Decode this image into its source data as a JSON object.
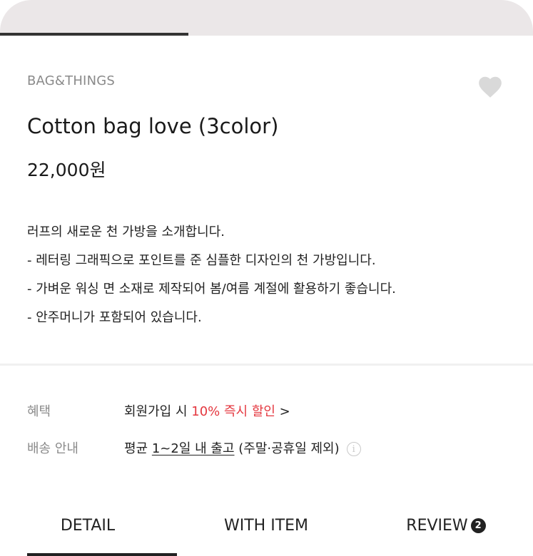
{
  "progress": {
    "value": 0.353
  },
  "product": {
    "brand": "BAG&THINGS",
    "title": "Cotton bag love (3color)",
    "price": "22,000원",
    "wishlist_icon": "heart-icon",
    "description": [
      "러프의 새로운 천 가방을 소개합니다.",
      "- 레터링 그래픽으로 포인트를 준 심플한 디자인의 천 가방입니다.",
      "- 가벼운 워싱 면 소재로 제작되어 봄/여름 계절에 활용하기 좋습니다.",
      "- 안주머니가 포함되어 있습니다."
    ]
  },
  "benefit": {
    "label": "혜택",
    "prefix": "회원가입 시 ",
    "highlight": "10% 즉시 할인",
    "suffix": " >",
    "highlight_color": "#e4373f"
  },
  "shipping": {
    "label": "배송 안내",
    "prefix": "평균 ",
    "underlined": "1~2일 내 출고",
    "suffix": " (주말·공휴일 제외)",
    "info_icon": "info-icon"
  },
  "tabs": [
    {
      "label": "DETAIL",
      "active": true
    },
    {
      "label": "WITH ITEM",
      "active": false
    },
    {
      "label": "REVIEW",
      "badge": "2",
      "active": false
    }
  ]
}
